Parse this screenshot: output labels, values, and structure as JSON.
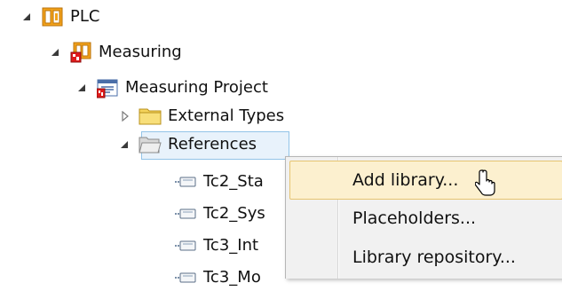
{
  "tree": {
    "plc": {
      "label": "PLC",
      "icon": "plc-icon",
      "expanded": true
    },
    "measuring": {
      "label": "Measuring",
      "icon": "plc-project-icon",
      "expanded": true
    },
    "measuring_project": {
      "label": "Measuring Project",
      "icon": "project-icon",
      "expanded": true
    },
    "external_types": {
      "label": "External Types",
      "icon": "folder-icon",
      "expanded": false
    },
    "references": {
      "label": "References",
      "icon": "folder-open-icon",
      "expanded": true,
      "selected": true
    },
    "ref_items": [
      {
        "label": "Tc2_Sta",
        "icon": "library-reference-icon"
      },
      {
        "label": "Tc2_Sys",
        "icon": "library-reference-icon"
      },
      {
        "label": "Tc3_Int",
        "icon": "library-reference-icon"
      },
      {
        "label": "Tc3_Mo",
        "icon": "library-reference-icon"
      }
    ]
  },
  "context_menu": {
    "items": [
      {
        "label": "Add library...",
        "highlighted": true
      },
      {
        "label": "Placeholders...",
        "highlighted": false
      },
      {
        "label": "Library repository...",
        "highlighted": false
      }
    ]
  },
  "colors": {
    "selection_fill": "#e8f2fb",
    "selection_border": "#93c4e8",
    "menu_background": "#f1f1f1",
    "menu_highlight": "#fcf0cf",
    "menu_highlight_border": "#e6c470",
    "plc_icon_orange": "#f3a21a",
    "plc_icon_red": "#e01b1b",
    "folder_yellow": "#f5d35b"
  }
}
